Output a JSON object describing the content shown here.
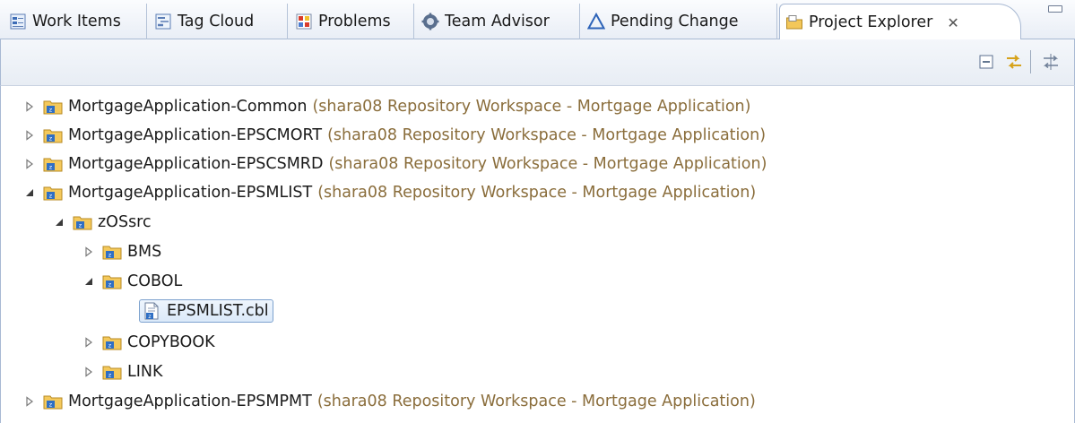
{
  "tabs": [
    {
      "label": "Work Items",
      "icon": "work-items-icon"
    },
    {
      "label": "Tag Cloud",
      "icon": "tag-cloud-icon"
    },
    {
      "label": "Problems",
      "icon": "problems-icon"
    },
    {
      "label": "Team Advisor",
      "icon": "team-advisor-icon"
    },
    {
      "label": "Pending Change",
      "icon": "pending-change-icon"
    },
    {
      "label": "Project Explorer",
      "icon": "project-explorer-icon",
      "active": true
    }
  ],
  "toolbar": {
    "collapse_all": "collapse-all-icon",
    "link_with_editor": "link-with-editor-icon",
    "view_menu": "view-menu-icon"
  },
  "tree": [
    {
      "label": "MortgageApplication-Common",
      "decoration": "(shara08 Repository Workspace - Mortgage Application)",
      "expanded": false
    },
    {
      "label": "MortgageApplication-EPSCMORT",
      "decoration": "(shara08 Repository Workspace - Mortgage Application)",
      "expanded": false
    },
    {
      "label": "MortgageApplication-EPSCSMRD",
      "decoration": "(shara08 Repository Workspace - Mortgage Application)",
      "expanded": false
    },
    {
      "label": "MortgageApplication-EPSMLIST",
      "decoration": "(shara08 Repository Workspace - Mortgage Application)",
      "expanded": true
    },
    {
      "label": "zOSsrc",
      "expanded": true
    },
    {
      "label": "BMS",
      "expanded": false
    },
    {
      "label": "COBOL",
      "expanded": true
    },
    {
      "label": "EPSMLIST.cbl",
      "selected": true
    },
    {
      "label": "COPYBOOK",
      "expanded": false
    },
    {
      "label": "LINK",
      "expanded": false
    },
    {
      "label": "MortgageApplication-EPSMPMT",
      "decoration": "(shara08 Repository Workspace - Mortgage Application)",
      "expanded": false
    }
  ],
  "colors": {
    "decoration_text": "#8a6d3b",
    "selection_border": "#7da2ce",
    "tab_border": "#a8b9d3"
  }
}
